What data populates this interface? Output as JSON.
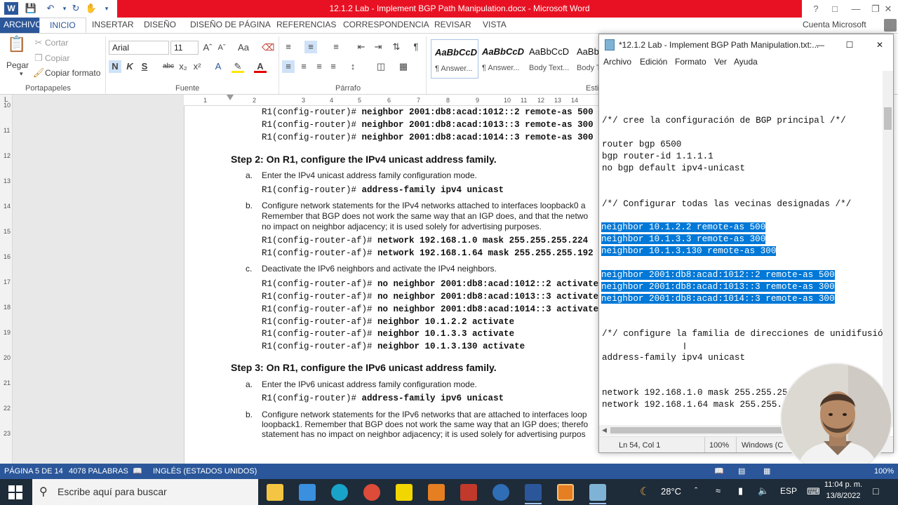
{
  "word": {
    "title": "12.1.2 Lab - Implement BGP Path Manipulation.docx - Microsoft Word",
    "account": "Cuenta Microsoft",
    "tabs": [
      "ARCHIVO",
      "INICIO",
      "INSERTAR",
      "DISEÑO",
      "DISEÑO DE PÁGINA",
      "REFERENCIAS",
      "CORRESPONDENCIA",
      "REVISAR",
      "VISTA"
    ],
    "clipboard": {
      "paste": "Pegar",
      "cut": "Cortar",
      "copy": "Copiar",
      "format_painter": "Copiar formato",
      "group": "Portapapeles"
    },
    "font": {
      "name": "Arial",
      "size": "11",
      "group": "Fuente",
      "bold": "N",
      "italic": "K",
      "underline": "S",
      "strike": "abc",
      "sub": "x₂",
      "sup": "x²"
    },
    "paragraph_group": "Párrafo",
    "styles": [
      {
        "preview": "AaBbCcD",
        "name": "¶ Answer..."
      },
      {
        "preview": "AaBbCcD",
        "name": "¶ Answer..."
      },
      {
        "preview": "AaBbCcD",
        "name": "Body Text..."
      },
      {
        "preview": "AaBbC",
        "name": "Body T"
      }
    ],
    "styles_group": "Esti",
    "ruler_h": [
      "1",
      "2",
      "3",
      "4",
      "5",
      "6",
      "7",
      "8",
      "9",
      "10",
      "11",
      "12",
      "13",
      "14"
    ],
    "ruler_v": [
      "10",
      "11",
      "12",
      "13",
      "14",
      "15",
      "16",
      "17",
      "18",
      "19",
      "20",
      "21",
      "22",
      "23"
    ]
  },
  "document": {
    "lines_top": [
      {
        "prompt": "R1(config-router)#",
        "cmd": " neighbor 2001:db8:acad:1012::2 remote-as 500"
      },
      {
        "prompt": "R1(config-router)#",
        "cmd": " neighbor 2001:db8:acad:1013::3 remote-as 300"
      },
      {
        "prompt": "R1(config-router)#",
        "cmd": " neighbor 2001:db8:acad:1014::3 remote-as 300"
      }
    ],
    "step2": "Step 2: On R1, configure the IPv4 unicast address family.",
    "step2a_marker": "a.",
    "step2a": "Enter the IPv4 unicast address family configuration mode.",
    "step2a_code": {
      "prompt": "R1(config-router)#",
      "cmd": " address-family ipv4 unicast"
    },
    "step2b_marker": "b.",
    "step2b": [
      "Configure network statements for the IPv4 networks attached to interfaces loopback0 a",
      "Remember that BGP does not work the same way that an IGP does, and that the netwo",
      "no impact on neighbor adjacency; it is used solely for advertising purposes."
    ],
    "step2b_code": [
      {
        "prompt": "R1(config-router-af)#",
        "cmd": " network 192.168.1.0 mask 255.255.255.224"
      },
      {
        "prompt": "R1(config-router-af)#",
        "cmd": " network 192.168.1.64 mask 255.255.255.192"
      }
    ],
    "step2c_marker": "c.",
    "step2c": "Deactivate the IPv6 neighbors and activate the IPv4 neighbors.",
    "step2c_code": [
      {
        "prompt": "R1(config-router-af)#",
        "cmd": " no neighbor 2001:db8:acad:1012::2 activate"
      },
      {
        "prompt": "R1(config-router-af)#",
        "cmd": " no neighbor 2001:db8:acad:1013::3 activate"
      },
      {
        "prompt": "R1(config-router-af)#",
        "cmd": " no neighbor 2001:db8:acad:1014::3 activate"
      },
      {
        "prompt": "R1(config-router-af)#",
        "cmd": " neighbor 10.1.2.2 activate"
      },
      {
        "prompt": "R1(config-router-af)#",
        "cmd": " neighbor 10.1.3.3 activate"
      },
      {
        "prompt": "R1(config-router-af)#",
        "cmd": " neighbor 10.1.3.130 activate"
      }
    ],
    "step3": "Step 3: On R1, configure the IPv6 unicast address family.",
    "step3a_marker": "a.",
    "step3a": "Enter the IPv6 unicast address family configuration mode.",
    "step3a_code": {
      "prompt": "R1(config-router)#",
      "cmd": " address-family ipv6 unicast"
    },
    "step3b_marker": "b.",
    "step3b": [
      "Configure network statements for the IPv6 networks that are attached to interfaces loop",
      "loopback1. Remember that BGP does not work the same way that an IGP does; therefo",
      "statement has no impact on neighbor adjacency; it is used solely for advertising purpos"
    ]
  },
  "notepad": {
    "title": "*12.1.2 Lab - Implement BGP Path Manipulation.txt:...",
    "menu": [
      "Archivo",
      "Edición",
      "Formato",
      "Ver",
      "Ayuda"
    ],
    "lines": [
      {
        "text": "/*/ cree la configuración de BGP principal /*/",
        "selected": false
      },
      {
        "text": "router bgp 6500",
        "selected": false
      },
      {
        "text": "bgp router-id 1.1.1.1",
        "selected": false
      },
      {
        "text": "no bgp default ipv4-unicast",
        "selected": false
      },
      {
        "text": "/*/ Configurar todas las vecinas designadas /*/",
        "selected": false
      },
      {
        "text": "neighbor 10.1.2.2 remote-as 500",
        "selected": true
      },
      {
        "text": "neighbor 10.1.3.3 remote-as 300",
        "selected": true
      },
      {
        "text": "neighbor 10.1.3.130 remote-as 300",
        "selected": true
      },
      {
        "text": "neighbor 2001:db8:acad:1012::2 remote-as 500",
        "selected": true
      },
      {
        "text": "neighbor 2001:db8:acad:1013::3 remote-as 300",
        "selected": true
      },
      {
        "text": "neighbor 2001:db8:acad:1014::3 remote-as 300",
        "selected": true
      },
      {
        "text": "/*/ configure la familia de direcciones de unidifusión",
        "selected": false
      },
      {
        "text": "address-family ipv4 unicast",
        "selected": false
      },
      {
        "text": "network 192.168.1.0 mask 255.255.25",
        "selected": false
      },
      {
        "text": "network 192.168.1.64 mask 255.255.",
        "selected": false
      }
    ],
    "status": {
      "position": "Ln 54, Col 1",
      "zoom": "100%",
      "encoding": "Windows (C"
    }
  },
  "statusbar": {
    "page": "PÁGINA 5 DE 14",
    "words": "4078 PALABRAS",
    "language": "INGLÉS (ESTADOS UNIDOS)",
    "zoom": "100%"
  },
  "taskbar": {
    "search_placeholder": "Escribe aquí para buscar",
    "temperature": "28°C",
    "lang": "ESP",
    "time": "11:04 p. m.",
    "date": "13/8/2022"
  }
}
